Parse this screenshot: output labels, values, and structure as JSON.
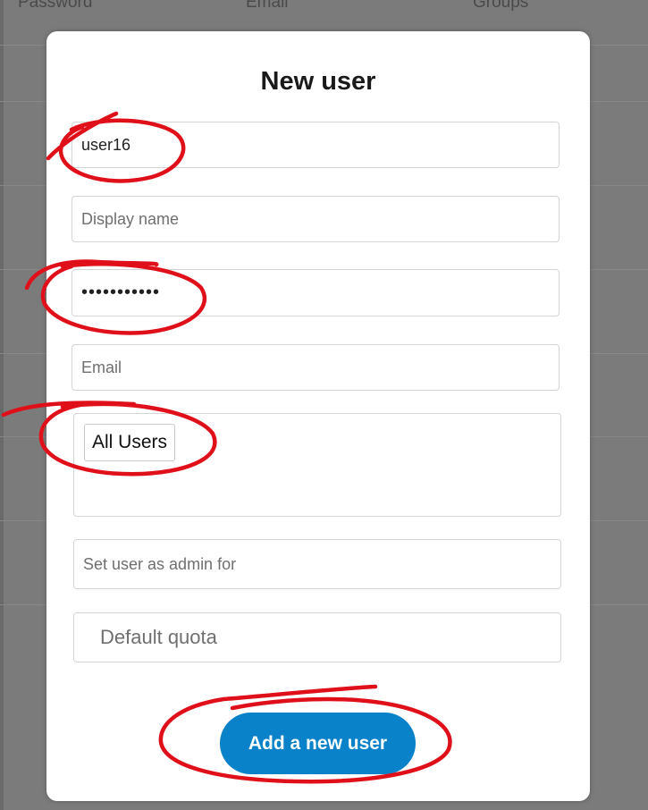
{
  "background_table": {
    "columns": [
      "Password",
      "Email",
      "Groups"
    ]
  },
  "modal": {
    "title": "New user",
    "fields": {
      "username_value": "user16",
      "display_name_placeholder": "Display name",
      "password_mask": "•••••••••••",
      "email_placeholder": "Email",
      "groups_selected": [
        "All Users"
      ],
      "admin_for_placeholder": "Set user as admin for",
      "quota_placeholder": "Default quota"
    },
    "submit_label": "Add a new user"
  },
  "colors": {
    "accent_button": "#0a82c9",
    "annotation_red": "#e0101a",
    "overlay": "#7b7b7b"
  }
}
